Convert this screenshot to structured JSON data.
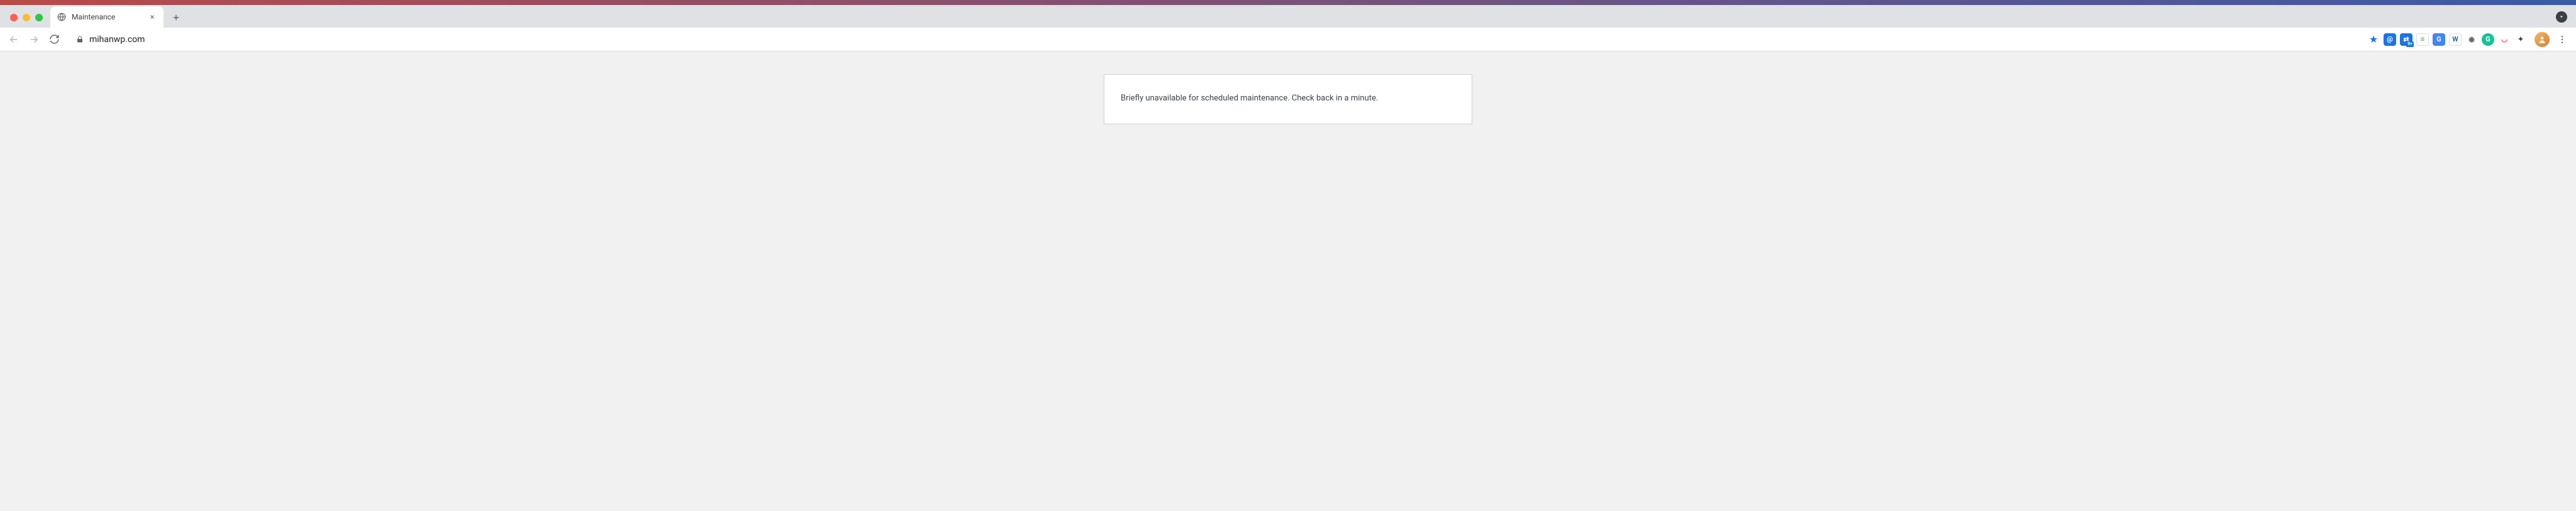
{
  "window": {
    "traffic_lights": [
      "close",
      "minimize",
      "maximize"
    ]
  },
  "tab": {
    "title": "Maintenance",
    "favicon": "globe-icon"
  },
  "toolbar": {
    "url": "mihanwp.com",
    "nav": {
      "back_enabled": false,
      "forward_enabled": false
    },
    "extensions": [
      {
        "name": "bookmark-star",
        "type": "star"
      },
      {
        "name": "ext-at",
        "glyph": "@",
        "bg": "#1a73e8",
        "fg": "#fff"
      },
      {
        "name": "ext-translate-badge",
        "glyph": "⇄",
        "bg": "#1a73e8",
        "fg": "#fff",
        "badge": "9+"
      },
      {
        "name": "ext-flag",
        "glyph": "≡",
        "bg": "#ffffff",
        "fg": "#2a9d4a",
        "border": true
      },
      {
        "name": "ext-gtranslate",
        "glyph": "G",
        "bg": "#4285f4",
        "fg": "#fff"
      },
      {
        "name": "ext-wordpress",
        "glyph": "W",
        "bg": "#ffffff",
        "fg": "#21759b",
        "border": true
      },
      {
        "name": "ext-camera",
        "glyph": "◉",
        "bg": "#ffffff",
        "fg": "#5f6368"
      },
      {
        "name": "ext-grammarly",
        "glyph": "G",
        "bg": "#15c39a",
        "fg": "#fff",
        "round": true
      },
      {
        "name": "ext-pocket",
        "glyph": "◡",
        "bg": "#ffffff",
        "fg": "#ef4056"
      },
      {
        "name": "ext-puzzle",
        "glyph": "✦",
        "bg": "#ffffff",
        "fg": "#3c4043"
      }
    ]
  },
  "page": {
    "message": "Briefly unavailable for scheduled maintenance. Check back in a minute."
  }
}
